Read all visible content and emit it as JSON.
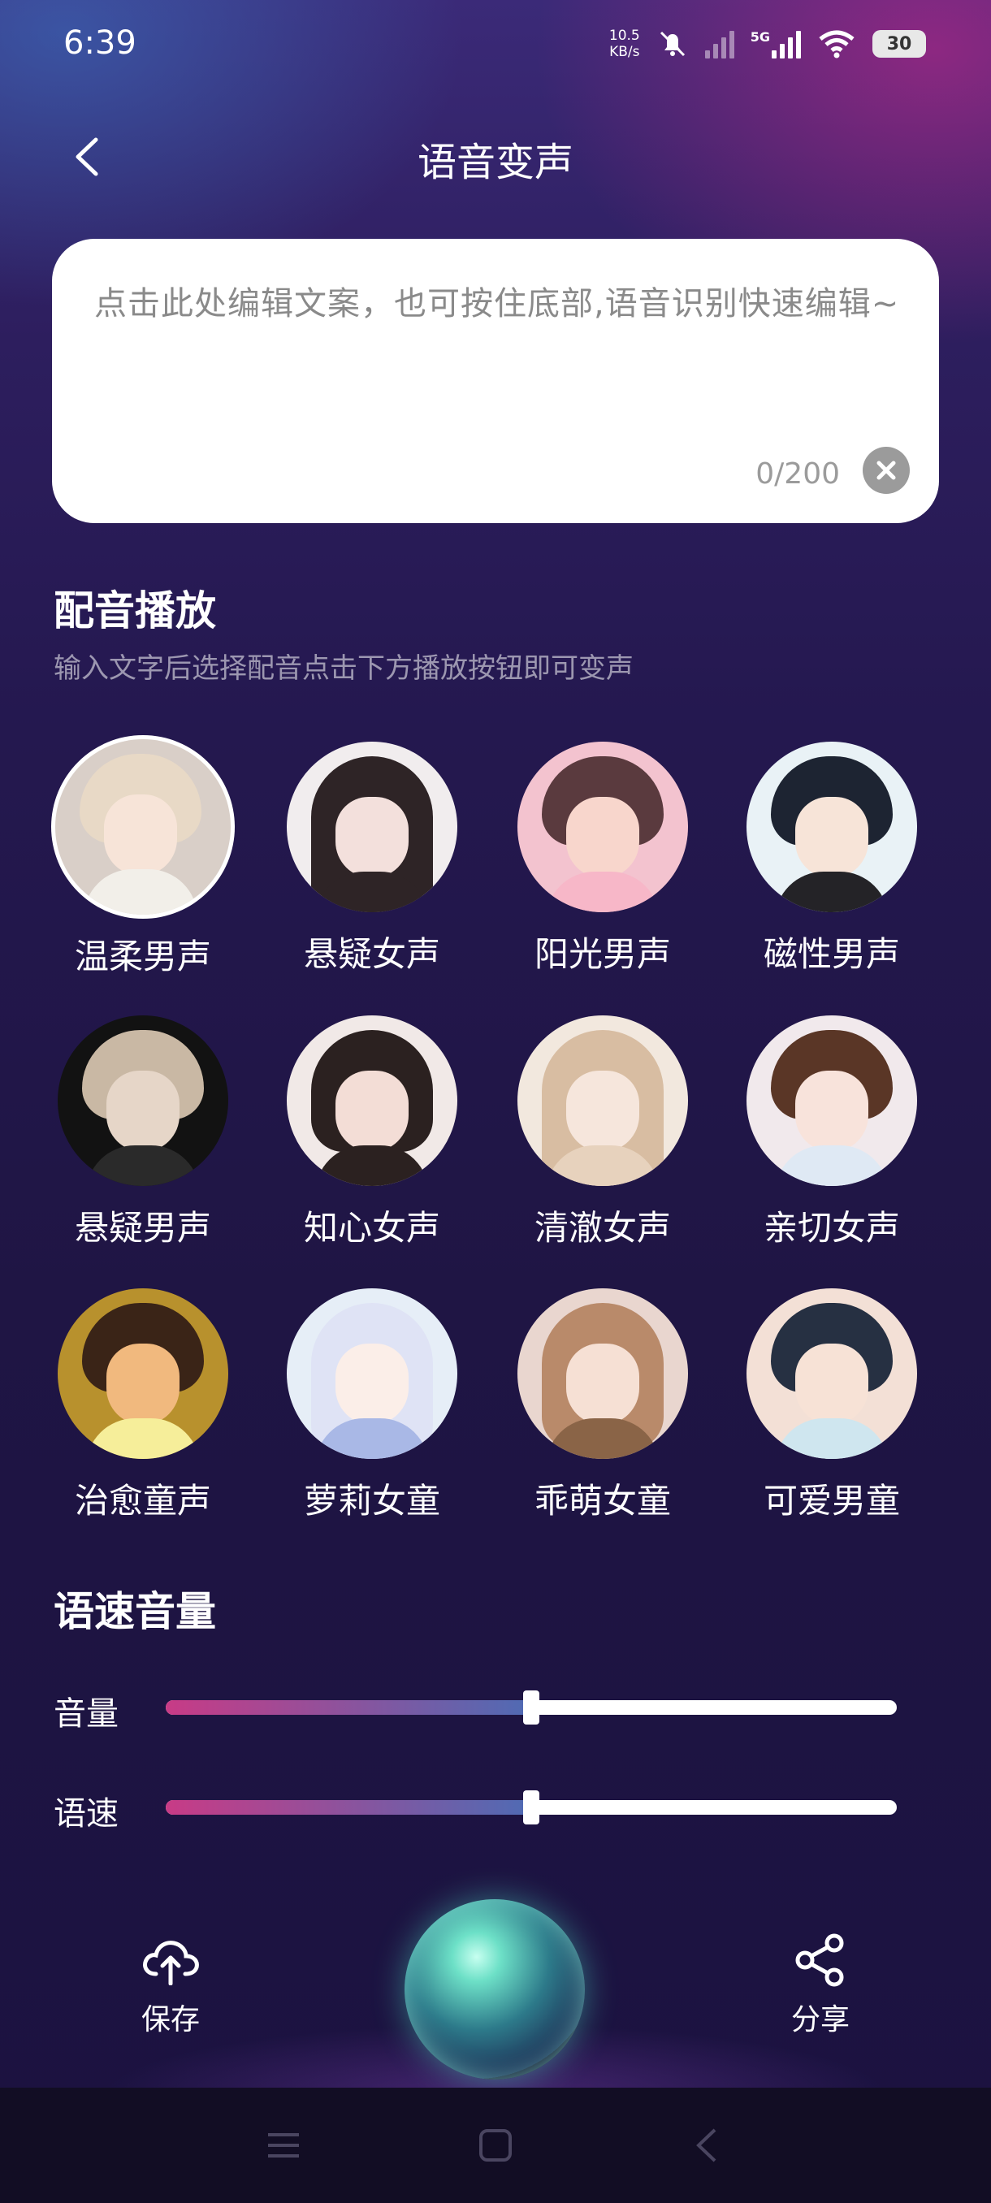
{
  "status_bar": {
    "time": "6:39",
    "net_speed_value": "10.5",
    "net_speed_unit": "KB/s",
    "network_type": "5G",
    "battery": "30"
  },
  "header": {
    "title": "语音变声"
  },
  "editor": {
    "placeholder": "点击此处编辑文案，也可按住底部,语音识别快速编辑~",
    "counter": "0/200"
  },
  "voice_section": {
    "title": "配音播放",
    "subtitle": "输入文字后选择配音点击下方播放按钮即可变声",
    "voices": [
      {
        "label": "温柔男声",
        "selected": true
      },
      {
        "label": "悬疑女声"
      },
      {
        "label": "阳光男声"
      },
      {
        "label": "磁性男声"
      },
      {
        "label": "悬疑男声"
      },
      {
        "label": "知心女声"
      },
      {
        "label": "清澈女声"
      },
      {
        "label": "亲切女声"
      },
      {
        "label": "治愈童声"
      },
      {
        "label": "萝莉女童"
      },
      {
        "label": "乖萌女童"
      },
      {
        "label": "可爱男童"
      }
    ]
  },
  "settings_section": {
    "title": "语速音量",
    "volume": {
      "label": "音量",
      "value_percent": 50
    },
    "speed": {
      "label": "语速",
      "value_percent": 50
    }
  },
  "bottom": {
    "save_label": "保存",
    "share_label": "分享"
  },
  "colors": {
    "slider_gradient_start": "#c83b86",
    "slider_gradient_end": "#4f6bb4"
  }
}
